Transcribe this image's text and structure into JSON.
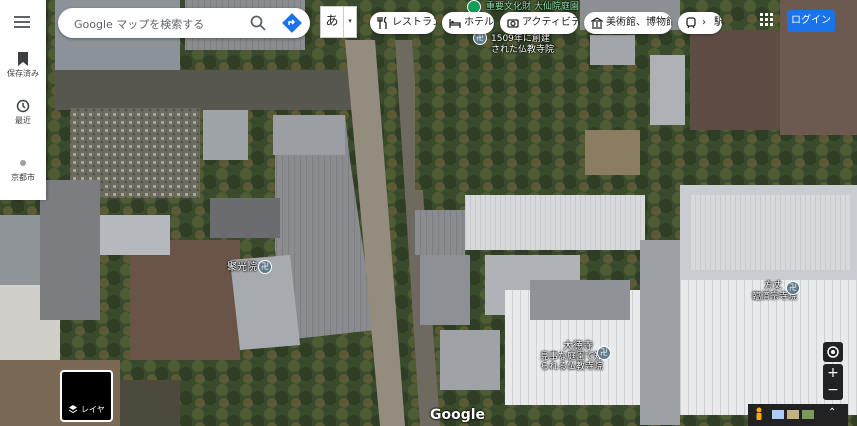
{
  "sidebar": {
    "items": [
      {
        "label": "保存済み",
        "icon": "bookmark-icon"
      },
      {
        "label": "最近",
        "icon": "history-icon"
      },
      {
        "label": "京都市",
        "icon": "location-thumb-icon"
      }
    ]
  },
  "search": {
    "placeholder": "Google マップを検索する"
  },
  "ime": {
    "label": "あ",
    "arrow": "▾"
  },
  "chips": [
    {
      "label": "レストラン",
      "icon": "restaurant-icon"
    },
    {
      "label": "ホテル",
      "icon": "hotel-icon"
    },
    {
      "label": "アクティビティ",
      "icon": "camera-icon"
    },
    {
      "label": "美術館、博物館",
      "icon": "museum-icon"
    },
    {
      "label": "駅",
      "icon": "train-icon"
    }
  ],
  "login": "ログイン",
  "layer": {
    "label": "レイヤ"
  },
  "brand": "Google",
  "pois": {
    "top_label_1": "重要文化財 大仙院庭園",
    "top_label_2": "1509年に創建",
    "top_label_3": "された仏教寺院",
    "jukoin": "聚光院",
    "daitokuji_1": "大徳寺",
    "daitokuji_2": "見事な庭園で知",
    "daitokuji_3": "られる仏教寺院",
    "daiji_1": "方丈",
    "daiji_2": "臨済宗寺院"
  },
  "colors": {
    "accent": "#1a73e8",
    "poi_green": "#0f9d58",
    "poi_gray": "#5f7a8c"
  }
}
